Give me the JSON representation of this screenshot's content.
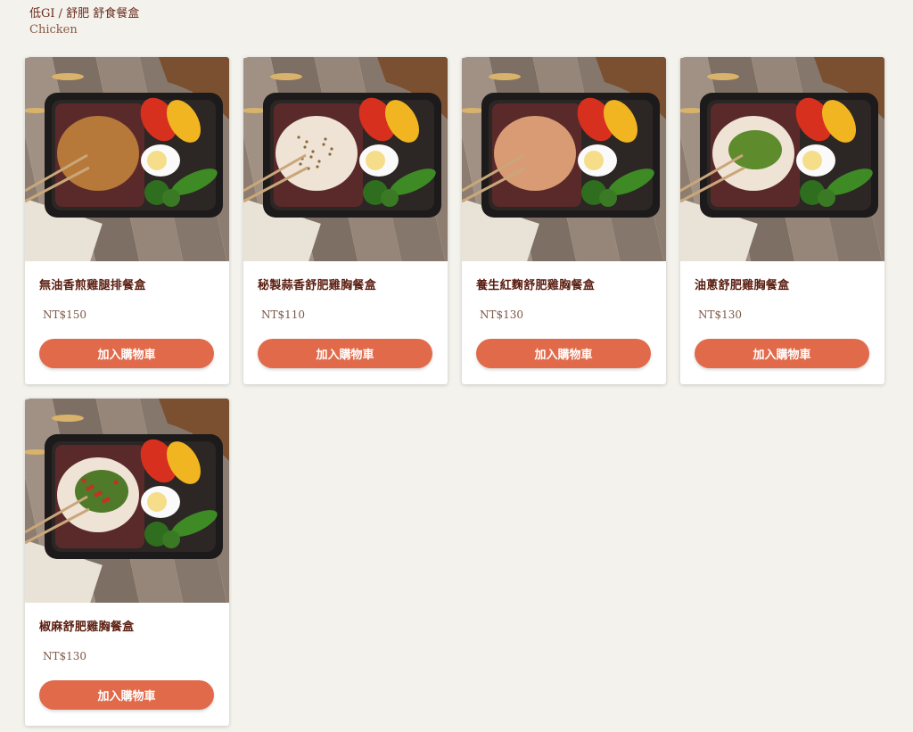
{
  "header": {
    "breadcrumb": "低GI / 舒肥 舒食餐盒",
    "subtitle": "Chicken"
  },
  "products": [
    {
      "name": "無油香煎雞腿排餐盒",
      "price": "NT$150",
      "cta": "加入購物車",
      "topping": "grilled-leg"
    },
    {
      "name": "秘製蒜香舒肥雞胸餐盒",
      "price": "NT$110",
      "cta": "加入購物車",
      "topping": "garlic-breast"
    },
    {
      "name": "養生紅麴舒肥雞胸餐盒",
      "price": "NT$130",
      "cta": "加入購物車",
      "topping": "red-yeast-breast"
    },
    {
      "name": "油蔥舒肥雞胸餐盒",
      "price": "NT$130",
      "cta": "加入購物車",
      "topping": "scallion-breast"
    },
    {
      "name": "椒麻舒肥雞胸餐盒",
      "price": "NT$130",
      "cta": "加入購物車",
      "topping": "pepper-breast"
    }
  ],
  "colors": {
    "background": "#f3f2ec",
    "accent": "#e16a4a",
    "title": "#5a1d10"
  }
}
